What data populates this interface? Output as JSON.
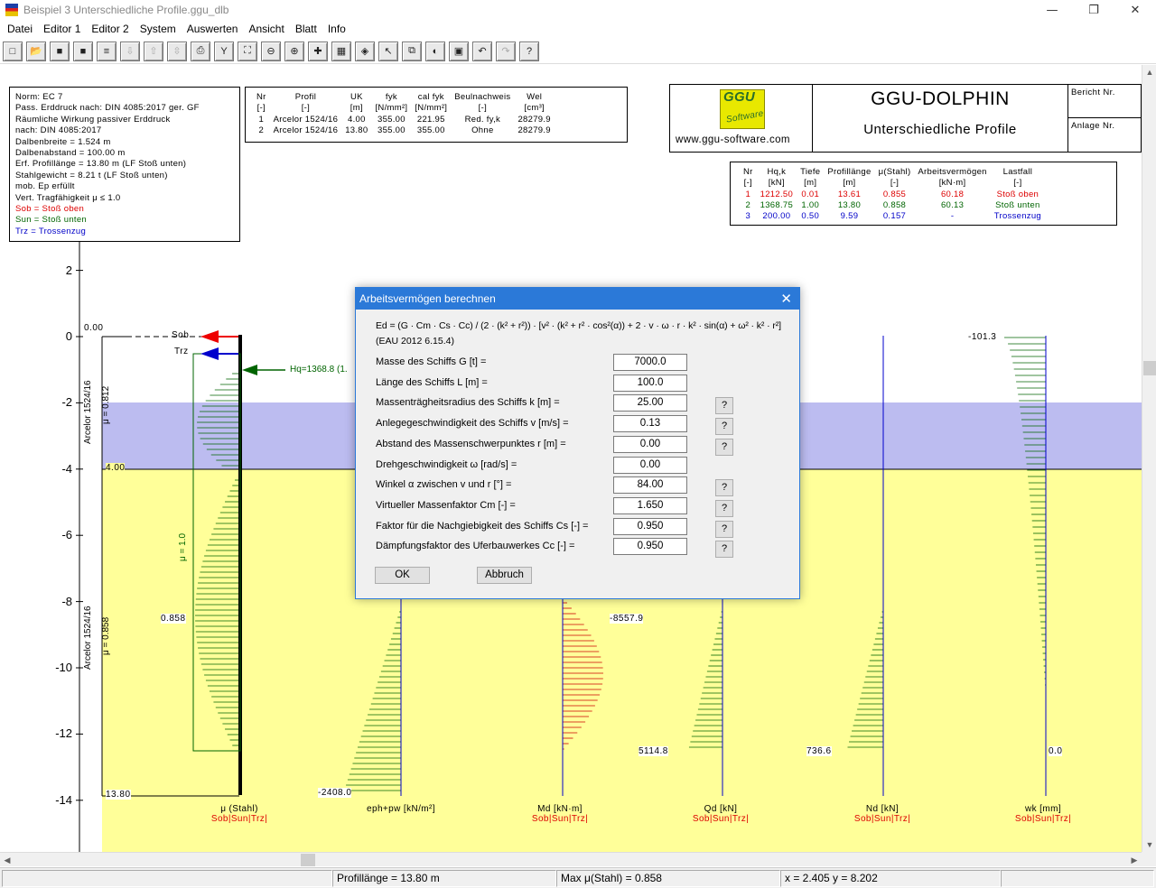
{
  "window": {
    "title": "Beispiel 3 Unterschiedliche Profile.ggu_dlb",
    "minimize": "—",
    "maximize": "❐",
    "close": "✕"
  },
  "menu": [
    "Datei",
    "Editor 1",
    "Editor 2",
    "System",
    "Auswerten",
    "Ansicht",
    "Blatt",
    "Info"
  ],
  "toolbar": [
    {
      "name": "new-file-icon",
      "glyph": "□"
    },
    {
      "name": "open-file-icon",
      "glyph": "📂"
    },
    {
      "name": "save-icon",
      "glyph": "■"
    },
    {
      "name": "save-as-icon",
      "glyph": "■"
    },
    {
      "name": "list-icon",
      "glyph": "≡"
    },
    {
      "name": "move-down-icon",
      "glyph": "⇩"
    },
    {
      "name": "move-up-icon",
      "glyph": "⇧"
    },
    {
      "name": "move-updown-icon",
      "glyph": "⇳"
    },
    {
      "name": "print-icon",
      "glyph": "⎙"
    },
    {
      "name": "pin-icon",
      "glyph": "Y"
    },
    {
      "name": "zoom-box-icon",
      "glyph": "⛶"
    },
    {
      "name": "zoom-out-icon",
      "glyph": "⊖"
    },
    {
      "name": "zoom-in-icon",
      "glyph": "⊕"
    },
    {
      "name": "crosshair-icon",
      "glyph": "✚"
    },
    {
      "name": "grid-icon",
      "glyph": "▦"
    },
    {
      "name": "paint-icon",
      "glyph": "◈"
    },
    {
      "name": "pointer-icon",
      "glyph": "↖"
    },
    {
      "name": "copy-icon",
      "glyph": "⧉"
    },
    {
      "name": "color-icon",
      "glyph": "◐"
    },
    {
      "name": "legend-icon",
      "glyph": "▣"
    },
    {
      "name": "undo-icon",
      "glyph": "↶"
    },
    {
      "name": "redo-icon",
      "glyph": "↷"
    },
    {
      "name": "help-icon",
      "glyph": "?"
    }
  ],
  "info_box": {
    "lines": [
      {
        "text": "Norm:  EC 7",
        "color": "#000"
      },
      {
        "text": "Pass. Erddruck nach: DIN 4085:2017 ger. GF",
        "color": "#000"
      },
      {
        "text": "Räumliche Wirkung passiver Erddruck",
        "color": "#000"
      },
      {
        "text": "nach: DIN 4085:2017",
        "color": "#000"
      },
      {
        "text": "Dalbenbreite = 1.524 m",
        "color": "#000"
      },
      {
        "text": "Dalbenabstand = 100.00 m",
        "color": "#000"
      },
      {
        "text": "Erf. Profillänge = 13.80 m (LF Stoß unten)",
        "color": "#000"
      },
      {
        "text": "Stahlgewicht = 8.21 t (LF Stoß unten)",
        "color": "#000"
      },
      {
        "text": "mob. Ep erfüllt",
        "color": "#000"
      },
      {
        "text": "Vert. Tragfähigkeit μ ≤ 1.0",
        "color": "#000"
      },
      {
        "text": "Sob = Stoß oben",
        "color": "#d00"
      },
      {
        "text": "Sun = Stoß unten",
        "color": "#006400"
      },
      {
        "text": "Trz = Trossenzug",
        "color": "#0000c8"
      }
    ]
  },
  "profile_table": {
    "headers": [
      "Nr",
      "Profil",
      "UK",
      "fyk",
      "cal fyk",
      "Beulnachweis",
      "Wel"
    ],
    "units": [
      "[-]",
      "[-]",
      "[m]",
      "[N/mm²]",
      "[N/mm²]",
      "[-]",
      "[cm³]"
    ],
    "rows": [
      [
        "1",
        "Arcelor 1524/16",
        "4.00",
        "355.00",
        "221.95",
        "Red. fy,k",
        "28279.9"
      ],
      [
        "2",
        "Arcelor 1524/16",
        "13.80",
        "355.00",
        "355.00",
        "Ohne",
        "28279.9"
      ]
    ]
  },
  "logo": {
    "text": "GGU",
    "subtext": "Software",
    "url": "www.ggu-software.com"
  },
  "project": {
    "app": "GGU-DOLPHIN",
    "title": "Unterschiedliche Profile",
    "bericht": "Bericht Nr.",
    "anlage": "Anlage Nr."
  },
  "results_table": {
    "headers": [
      "Nr",
      "Hq,k",
      "Tiefe",
      "Profillänge",
      "μ(Stahl)",
      "Arbeitsvermögen",
      "Lastfall"
    ],
    "units": [
      "[-]",
      "[kN]",
      "[m]",
      "[m]",
      "[-]",
      "[kN·m]",
      "[-]"
    ],
    "rows": [
      {
        "color": "#d00",
        "cells": [
          "1",
          "1212.50",
          "0.01",
          "13.61",
          "0.855",
          "60.18",
          "Stoß oben"
        ]
      },
      {
        "color": "#006400",
        "cells": [
          "2",
          "1368.75",
          "1.00",
          "13.80",
          "0.858",
          "60.13",
          "Stoß unten"
        ]
      },
      {
        "color": "#0000c8",
        "cells": [
          "3",
          "200.00",
          "0.50",
          "9.59",
          "0.157",
          "-",
          "Trossenzug"
        ]
      }
    ]
  },
  "axis": {
    "ticks": [
      "2",
      "0",
      "-2",
      "-4",
      "-6",
      "-8",
      "-10",
      "-12",
      "-14"
    ]
  },
  "drawing_labels": {
    "top_level": "0.00",
    "layer_level": "4.00",
    "bottom_level": "13.80",
    "sob": "Sob",
    "trz": "Trz",
    "hq": "Hq=1368.8 (1.",
    "profile1": "Arcelor 1524/16",
    "mu1": "μ = 0.812",
    "profile2": "Arcelor 1524/16",
    "mu2": "μ = 0.858",
    "mu_one": "μ = 1.0",
    "mu_val": "0.858",
    "eph_val": "-2408.0",
    "md_val": "-8557.9",
    "qd_val": "5114.8",
    "nd_val": "736.6",
    "wk_top": "-101.3",
    "wk_bottom": "0.0"
  },
  "diagram_titles": [
    {
      "title": "μ (Stahl)",
      "legend": "Sob|Sun|Trz|"
    },
    {
      "title": "eph+pw  [kN/m²]",
      "legend": ""
    },
    {
      "title": "Md [kN·m]",
      "legend": "Sob|Sun|Trz|"
    },
    {
      "title": "Qd [kN]",
      "legend": "Sob|Sun|Trz|"
    },
    {
      "title": "Nd [kN]",
      "legend": "Sob|Sun|Trz|"
    },
    {
      "title": "wk [mm]",
      "legend": "Sob|Sun|Trz|"
    }
  ],
  "dialog": {
    "title": "Arbeitsvermögen berechnen",
    "formula": "Ed = (G · Cm · Cs · Cc) / (2 · (k² + r²)) · [v² · (k² + r² · cos²(α)) + 2 · v · ω · r · k² · sin(α) + ω² · k² · r²]",
    "reference": "(EAU 2012 6.15.4)",
    "fields": [
      {
        "label": "Masse des Schiffs G [t] =",
        "value": "7000.0",
        "help": false
      },
      {
        "label": "Länge des Schiffs L [m] =",
        "value": "100.0",
        "help": false
      },
      {
        "label": "Massenträgheitsradius des Schiffs k [m] =",
        "value": "25.00",
        "help": true
      },
      {
        "label": "Anlegegeschwindigkeit des Schiffs v [m/s] =",
        "value": "0.13",
        "help": true
      },
      {
        "label": "Abstand des Massenschwerpunktes r [m] =",
        "value": "0.00",
        "help": true
      },
      {
        "label": "Drehgeschwindigkeit ω [rad/s] =",
        "value": "0.00",
        "help": false
      },
      {
        "label": "Winkel α zwischen v und r [°] =",
        "value": "84.00",
        "help": true
      },
      {
        "label": "Virtueller Massenfaktor Cm [-] =",
        "value": "1.650",
        "help": true
      },
      {
        "label": "Faktor für die Nachgiebigkeit des Schiffs Cs [-] =",
        "value": "0.950",
        "help": true
      },
      {
        "label": "Dämpfungsfaktor des Uferbauwerkes Cc [-] =",
        "value": "0.950",
        "help": true
      }
    ],
    "help_label": "?",
    "ok": "OK",
    "cancel": "Abbruch"
  },
  "status": {
    "profile": "Profillänge = 13.80 m",
    "mu": "Max μ(Stahl) = 0.858",
    "coords": "x =  2.405 y =  8.202"
  }
}
